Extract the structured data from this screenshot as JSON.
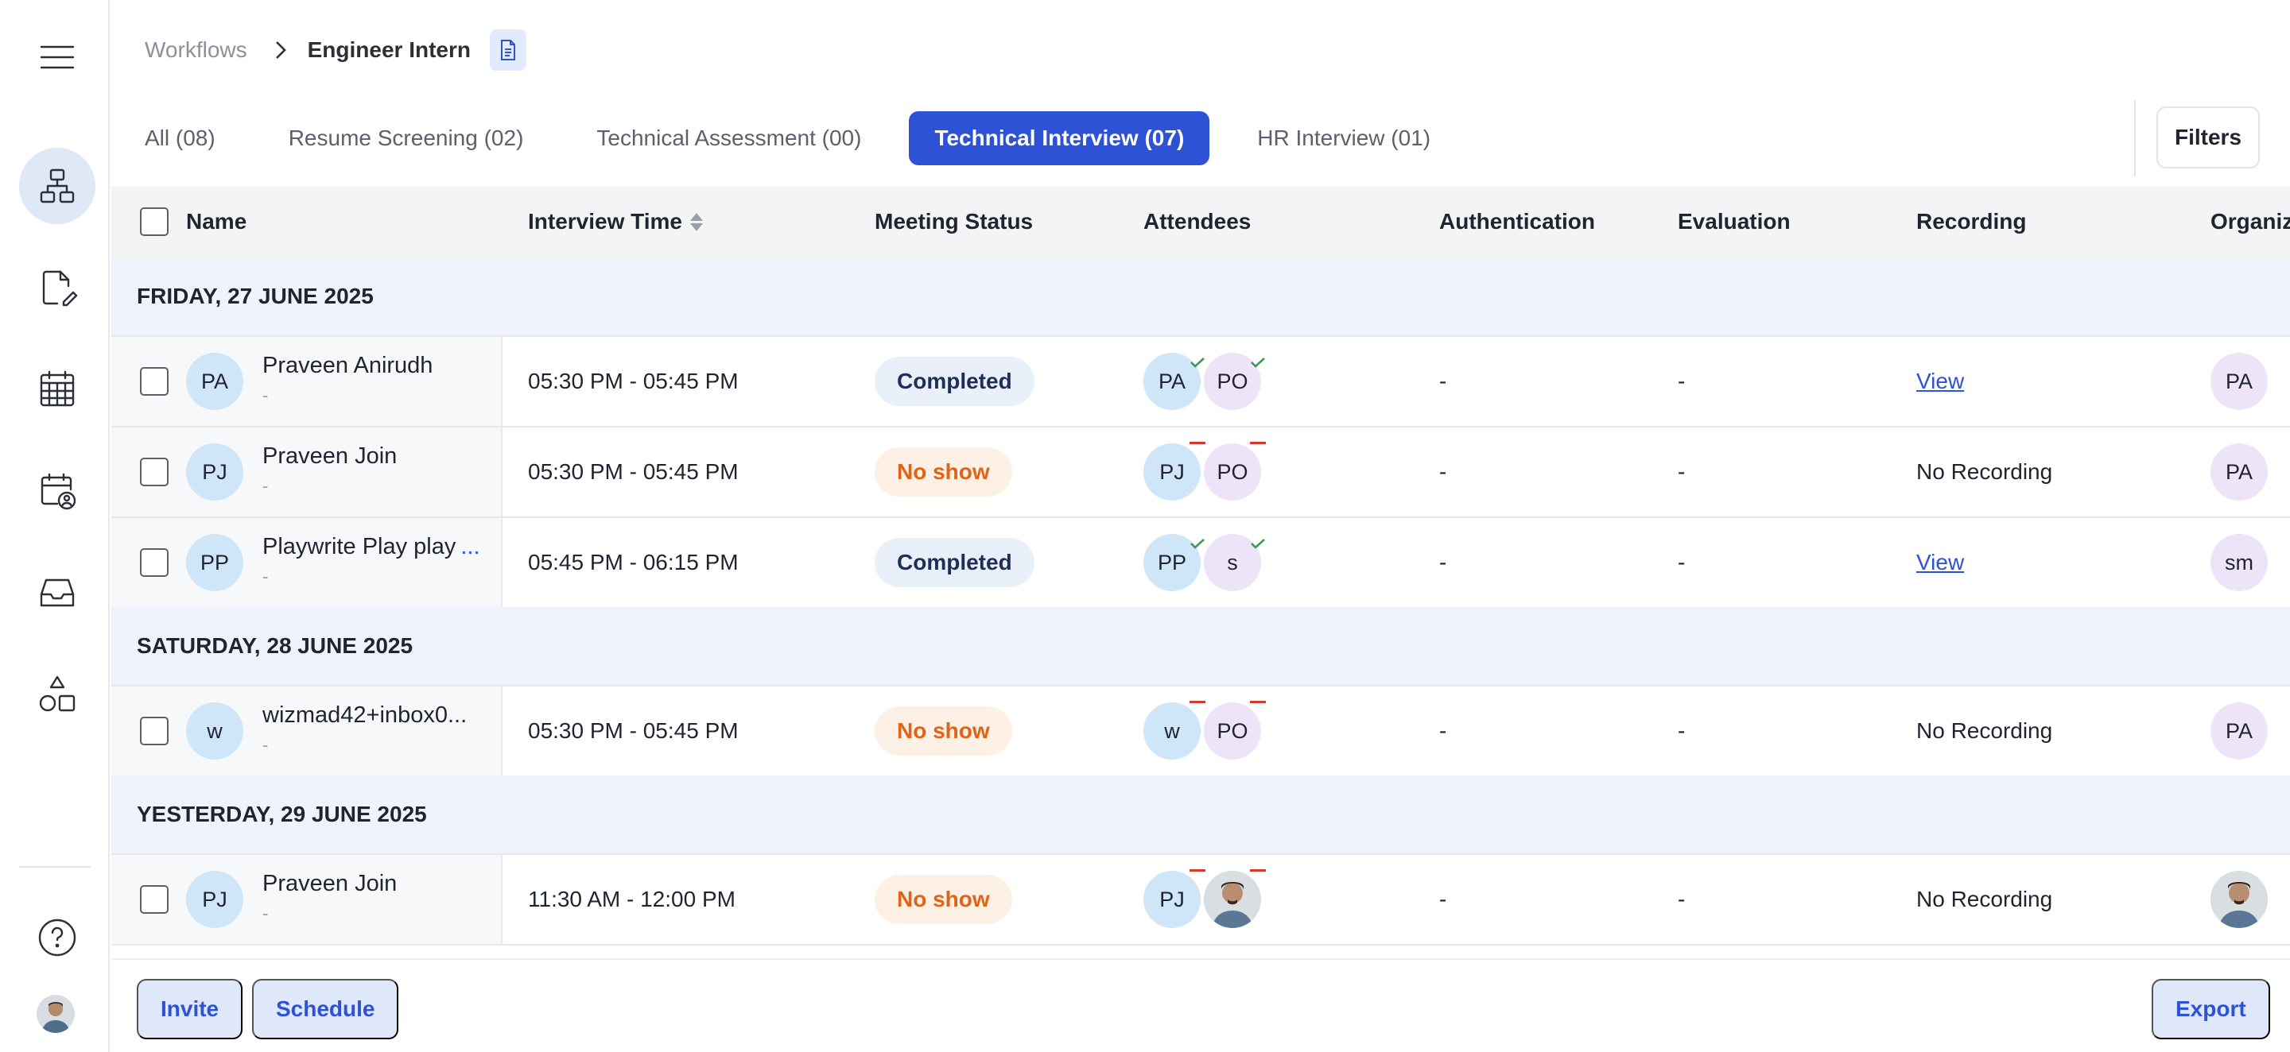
{
  "breadcrumb": {
    "root": "Workflows",
    "current": "Engineer Intern"
  },
  "tabs": [
    {
      "label": "All (08)",
      "active": false
    },
    {
      "label": "Resume Screening (02)",
      "active": false
    },
    {
      "label": "Technical Assessment (00)",
      "active": false
    },
    {
      "label": "Technical Interview (07)",
      "active": true
    },
    {
      "label": "HR Interview (01)",
      "active": false
    }
  ],
  "filters_label": "Filters",
  "columns": {
    "name": "Name",
    "interview_time": "Interview Time",
    "meeting_status": "Meeting Status",
    "attendees": "Attendees",
    "authentication": "Authentication",
    "evaluation": "Evaluation",
    "recording": "Recording",
    "organizer": "Organize"
  },
  "groups": [
    {
      "label": "FRIDAY, 27 JUNE 2025",
      "rows": [
        {
          "initials": "PA",
          "name": "Praveen Anirudh",
          "sub": "-",
          "time": "05:30 PM - 05:45 PM",
          "status": "Completed",
          "status_type": "completed",
          "attendees": [
            {
              "initials": "PA",
              "color": "blue",
              "mark": "check"
            },
            {
              "initials": "PO",
              "color": "purple",
              "mark": "check"
            }
          ],
          "authentication": "-",
          "evaluation": "-",
          "recording": "View",
          "recording_link": true,
          "organizer": "PA"
        },
        {
          "initials": "PJ",
          "name": "Praveen Join",
          "sub": "-",
          "time": "05:30 PM - 05:45 PM",
          "status": "No show",
          "status_type": "noshow",
          "attendees": [
            {
              "initials": "PJ",
              "color": "blue",
              "mark": "dash"
            },
            {
              "initials": "PO",
              "color": "purple",
              "mark": "dash"
            }
          ],
          "authentication": "-",
          "evaluation": "-",
          "recording": "No Recording",
          "recording_link": false,
          "organizer": "PA"
        },
        {
          "initials": "PP",
          "name": "Playwrite Play play",
          "ellipsis": "...",
          "sub": "-",
          "time": "05:45 PM - 06:15 PM",
          "status": "Completed",
          "status_type": "completed",
          "attendees": [
            {
              "initials": "PP",
              "color": "blue",
              "mark": "check"
            },
            {
              "initials": "s",
              "color": "purple",
              "mark": "check"
            }
          ],
          "authentication": "-",
          "evaluation": "-",
          "recording": "View",
          "recording_link": true,
          "organizer": "sm"
        }
      ]
    },
    {
      "label": "SATURDAY, 28 JUNE 2025",
      "rows": [
        {
          "initials": "w",
          "name": "wizmad42+inbox0...",
          "sub": "-",
          "time": "05:30 PM - 05:45 PM",
          "status": "No show",
          "status_type": "noshow",
          "attendees": [
            {
              "initials": "w",
              "color": "blue",
              "mark": "dash"
            },
            {
              "initials": "PO",
              "color": "purple",
              "mark": "dash"
            }
          ],
          "authentication": "-",
          "evaluation": "-",
          "recording": "No Recording",
          "recording_link": false,
          "organizer": "PA"
        }
      ]
    },
    {
      "label": "YESTERDAY, 29 JUNE 2025",
      "rows": [
        {
          "initials": "PJ",
          "name": "Praveen Join",
          "sub": "-",
          "time": "11:30 AM - 12:00 PM",
          "status": "No show",
          "status_type": "noshow",
          "attendees": [
            {
              "initials": "PJ",
              "color": "blue",
              "mark": "dash"
            },
            {
              "initials": "",
              "color": "photo",
              "mark": "dash"
            }
          ],
          "authentication": "-",
          "evaluation": "-",
          "recording": "No Recording",
          "recording_link": false,
          "organizer": ""
        }
      ]
    }
  ],
  "bottom": {
    "invite": "Invite",
    "schedule": "Schedule",
    "export": "Export"
  },
  "colors": {
    "primary": "#2e52d6",
    "completed_text": "#1f2e58",
    "noshow_text": "#e06316",
    "group_bg": "#eef3fc"
  }
}
